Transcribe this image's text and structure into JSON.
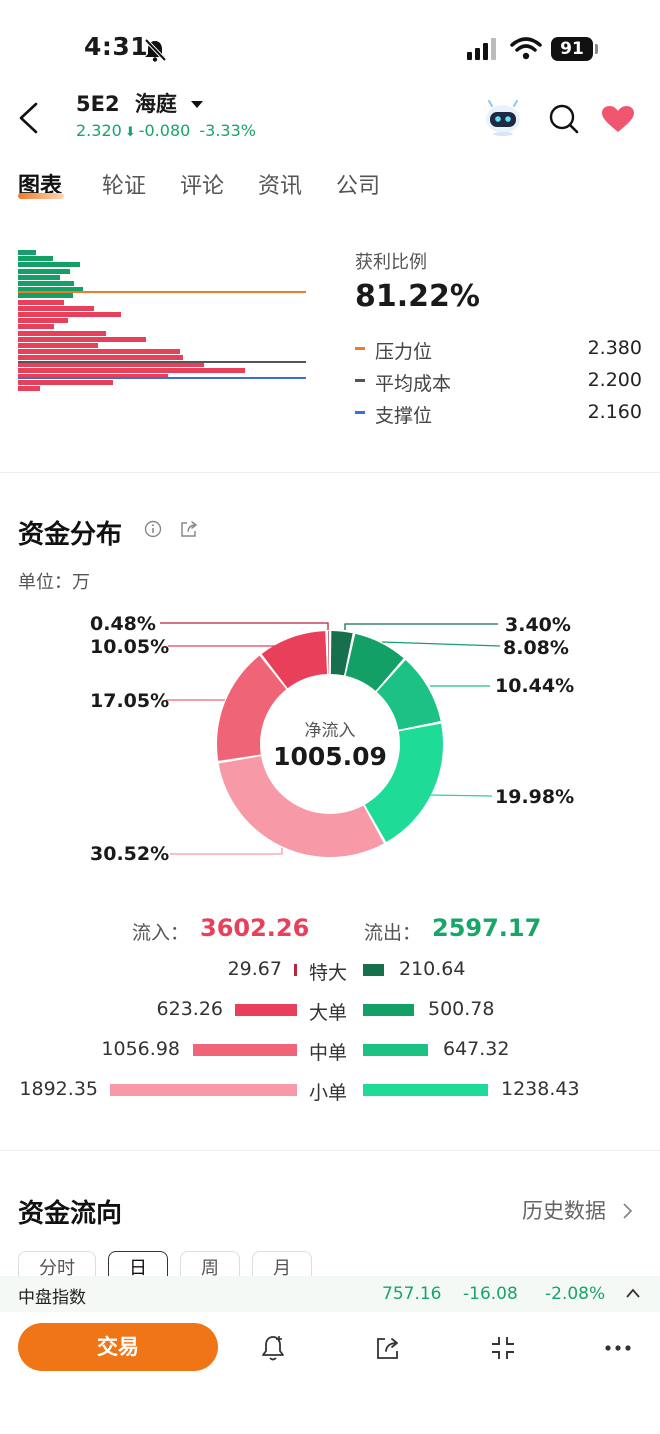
{
  "status_bar": {
    "time": "4:31",
    "battery": "91"
  },
  "header": {
    "code": "5E2",
    "name": "海庭",
    "price": "2.320",
    "change": "-0.080",
    "change_pct": "-3.33%"
  },
  "tabs": [
    "图表",
    "轮证",
    "评论",
    "资讯",
    "公司"
  ],
  "profit_ratio": {
    "label": "获利比例",
    "value": "81.22%",
    "legend": [
      {
        "label": "压力位",
        "value": "2.380",
        "color": "#f07a2a"
      },
      {
        "label": "平均成本",
        "value": "2.200",
        "color": "#555555"
      },
      {
        "label": "支撑位",
        "value": "2.160",
        "color": "#3b6fd6"
      }
    ]
  },
  "fund_distribution": {
    "title": "资金分布",
    "unit": "单位：万",
    "center_label": "净流入",
    "center_value": "1005.09",
    "left_percents": [
      "0.48%",
      "10.05%",
      "17.05%",
      "30.52%"
    ],
    "right_percents": [
      "3.40%",
      "8.08%",
      "10.44%",
      "19.98%"
    ],
    "inflow_label": "流入：",
    "inflow_value": "3602.26",
    "outflow_label": "流出：",
    "outflow_value": "2597.17",
    "rows": [
      {
        "category": "特大",
        "in": "29.67",
        "out": "210.64",
        "in_num": 29.67,
        "out_num": 210.64
      },
      {
        "category": "大单",
        "in": "623.26",
        "out": "500.78",
        "in_num": 623.26,
        "out_num": 500.78
      },
      {
        "category": "中单",
        "in": "1056.98",
        "out": "647.32",
        "in_num": 1056.98,
        "out_num": 647.32
      },
      {
        "category": "小单",
        "in": "1892.35",
        "out": "1238.43",
        "in_num": 1892.35,
        "out_num": 1238.43
      }
    ],
    "colors": {
      "in": [
        "#b8243f",
        "#e8405a",
        "#f06478",
        "#f799a6"
      ],
      "out": [
        "#15704b",
        "#13a067",
        "#1cc284",
        "#1edb97"
      ]
    }
  },
  "fund_flow": {
    "title": "资金流向",
    "history_link": "历史数据",
    "tabs": [
      "分时",
      "日",
      "周",
      "月"
    ]
  },
  "ticker": {
    "name": "中盘指数",
    "value": "757.16",
    "change": "-16.08",
    "change_pct": "-2.08%"
  },
  "bottom": {
    "trade_label": "交易"
  },
  "colors": {
    "up": "#e8405a",
    "down": "#17a56a",
    "accent": "#ef7517"
  },
  "chart_data": [
    {
      "type": "bar",
      "title": "",
      "orientation": "horizontal",
      "description_source": "chip distribution histogram (price levels top=high to bottom=low)",
      "series": [
        {
          "name": "",
          "color": "#13a067",
          "values": [
            18,
            35,
            62,
            52,
            42,
            56,
            65,
            55
          ]
        },
        {
          "name": "",
          "color": "#e8405a",
          "values": [
            46,
            76,
            103,
            50,
            36,
            88,
            128,
            80,
            162,
            165,
            186,
            227,
            150,
            95,
            22
          ]
        }
      ],
      "reference_lines": {
        "pressure": 2.38,
        "avg_cost": 2.2,
        "support": 2.16
      }
    },
    {
      "type": "pie",
      "title": "",
      "slices": [
        {
          "label": "3.40%",
          "value": 3.4,
          "color": "#15704b"
        },
        {
          "label": "8.08%",
          "value": 8.08,
          "color": "#13a067"
        },
        {
          "label": "10.44%",
          "value": 10.44,
          "color": "#1cc284"
        },
        {
          "label": "19.98%",
          "value": 19.98,
          "color": "#1edb97"
        },
        {
          "label": "30.52%",
          "value": 30.52,
          "color": "#f799a6"
        },
        {
          "label": "17.05%",
          "value": 17.05,
          "color": "#f06478"
        },
        {
          "label": "10.05%",
          "value": 10.05,
          "color": "#e8405a"
        },
        {
          "label": "0.48%",
          "value": 0.48,
          "color": "#b8243f"
        }
      ]
    }
  ]
}
